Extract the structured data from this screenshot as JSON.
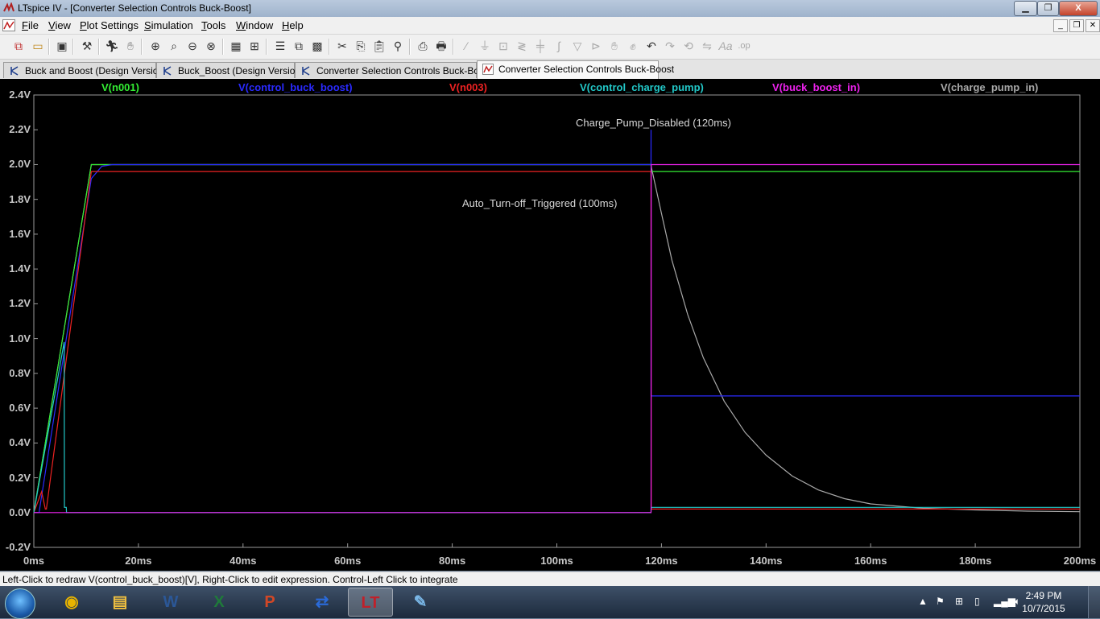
{
  "window": {
    "title": "LTspice IV - [Converter Selection Controls Buck-Boost]",
    "min_label": "▁",
    "max_label": "❐",
    "close_label": "X"
  },
  "menu": [
    {
      "key": "F",
      "rest": "ile"
    },
    {
      "key": "V",
      "rest": "iew"
    },
    {
      "key": "P",
      "rest": "lot Settings"
    },
    {
      "key": "S",
      "rest": "imulation"
    },
    {
      "key": "T",
      "rest": "ools"
    },
    {
      "key": "W",
      "rest": "indow"
    },
    {
      "key": "H",
      "rest": "elp"
    }
  ],
  "tabs": [
    {
      "label": "Buck and Boost (Design Version)"
    },
    {
      "label": "Buck_Boost (Design Version)"
    },
    {
      "label": "Converter Selection Controls Buck-Boost"
    },
    {
      "label": "Converter Selection Controls Buck-Boost"
    }
  ],
  "legend": [
    {
      "name": "V(n001)",
      "color": "#33ee33"
    },
    {
      "name": "V(control_buck_boost)",
      "color": "#2a2aff"
    },
    {
      "name": "V(n003)",
      "color": "#ee2222"
    },
    {
      "name": "V(control_charge_pump)",
      "color": "#22c8c8"
    },
    {
      "name": "V(buck_boost_in)",
      "color": "#ee22ee"
    },
    {
      "name": "V(charge_pump_in)",
      "color": "#a8a8a8"
    }
  ],
  "chart_data": {
    "type": "line",
    "x_unit": "ms",
    "y_unit": "V",
    "xlim": [
      0,
      200
    ],
    "ylim": [
      -0.2,
      2.4
    ],
    "x_ticks": [
      "0ms",
      "20ms",
      "40ms",
      "60ms",
      "80ms",
      "100ms",
      "120ms",
      "140ms",
      "160ms",
      "180ms",
      "200ms"
    ],
    "y_ticks": [
      "2.4V",
      "2.2V",
      "2.0V",
      "1.8V",
      "1.6V",
      "1.4V",
      "1.2V",
      "1.0V",
      "0.8V",
      "0.6V",
      "0.4V",
      "0.2V",
      "0.0V",
      "-0.2V"
    ],
    "x_tick_values": [
      0,
      20,
      40,
      60,
      80,
      100,
      120,
      140,
      160,
      180,
      200
    ],
    "y_tick_values": [
      2.4,
      2.2,
      2.0,
      1.8,
      1.6,
      1.4,
      1.2,
      1.0,
      0.8,
      0.6,
      0.4,
      0.2,
      0.0,
      -0.2
    ],
    "series": [
      {
        "name": "V(charge_pump_in)",
        "color": "#a8a8a8",
        "x": [
          0,
          11,
          118,
          118.1,
          120,
          122,
          125,
          128,
          132,
          136,
          140,
          145,
          150,
          155,
          160,
          170,
          180,
          190,
          200
        ],
        "y": [
          0,
          2.0,
          2.0,
          1.98,
          1.72,
          1.45,
          1.14,
          0.89,
          0.64,
          0.46,
          0.33,
          0.21,
          0.13,
          0.08,
          0.05,
          0.025,
          0.015,
          0.008,
          0.005
        ]
      },
      {
        "name": "V(n001)",
        "color": "#33ee33",
        "x": [
          0,
          11,
          118,
          118.1,
          200
        ],
        "y": [
          0,
          2.0,
          2.0,
          1.96,
          1.96
        ]
      },
      {
        "name": "V(control_buck_boost)",
        "color": "#2a2aff",
        "x": [
          0,
          1,
          11,
          13,
          15,
          118,
          118.01,
          118.02,
          200
        ],
        "y": [
          0,
          0,
          1.92,
          1.99,
          2.0,
          2.0,
          2.2,
          0.67,
          0.67
        ]
      },
      {
        "name": "V(n003)",
        "color": "#ee2222",
        "x": [
          0,
          1.5,
          2.2,
          2.4,
          11,
          118,
          118.05,
          200
        ],
        "y": [
          0,
          0.12,
          0.02,
          0.02,
          1.96,
          1.96,
          0.02,
          0.02
        ]
      },
      {
        "name": "V(control_charge_pump)",
        "color": "#22c8c8",
        "x": [
          0,
          5.8,
          5.85,
          6.2,
          6.25,
          118,
          118.05,
          200
        ],
        "y": [
          0,
          0.98,
          0.03,
          0.03,
          0.0,
          0.0,
          0.03,
          0.03
        ]
      },
      {
        "name": "V(buck_boost_in)",
        "color": "#ee22ee",
        "x": [
          0,
          118,
          118.02,
          118.05,
          200
        ],
        "y": [
          0,
          0,
          0.0,
          2.0,
          2.0
        ]
      }
    ],
    "annotations": [
      {
        "text": "Charge_Pump_Disabled (120ms)"
      },
      {
        "text": "Auto_Turn-off_Triggered (100ms)"
      }
    ]
  },
  "status": "Left-Click to redraw V(control_buck_boost)[V],  Right-Click to edit expression. Control-Left Click to integrate",
  "taskbar": {
    "apps": [
      {
        "icon": "chrome-icon",
        "glyph": "◉",
        "color": "#e8b400"
      },
      {
        "icon": "explorer-icon",
        "glyph": "▤",
        "color": "#f0c040"
      },
      {
        "icon": "word-icon",
        "glyph": "W",
        "color": "#2b5797"
      },
      {
        "icon": "excel-icon",
        "glyph": "X",
        "color": "#1f7a3a"
      },
      {
        "icon": "powerpoint-icon",
        "glyph": "P",
        "color": "#d24726"
      },
      {
        "icon": "remote-desktop-icon",
        "glyph": "⇄",
        "color": "#2a6ad8"
      },
      {
        "icon": "ltspice-icon",
        "glyph": "LT",
        "color": "#c0202a"
      },
      {
        "icon": "notepad-icon",
        "glyph": "✎",
        "color": "#7ab8e8"
      }
    ],
    "time": "2:49 PM",
    "date": "10/7/2015"
  }
}
